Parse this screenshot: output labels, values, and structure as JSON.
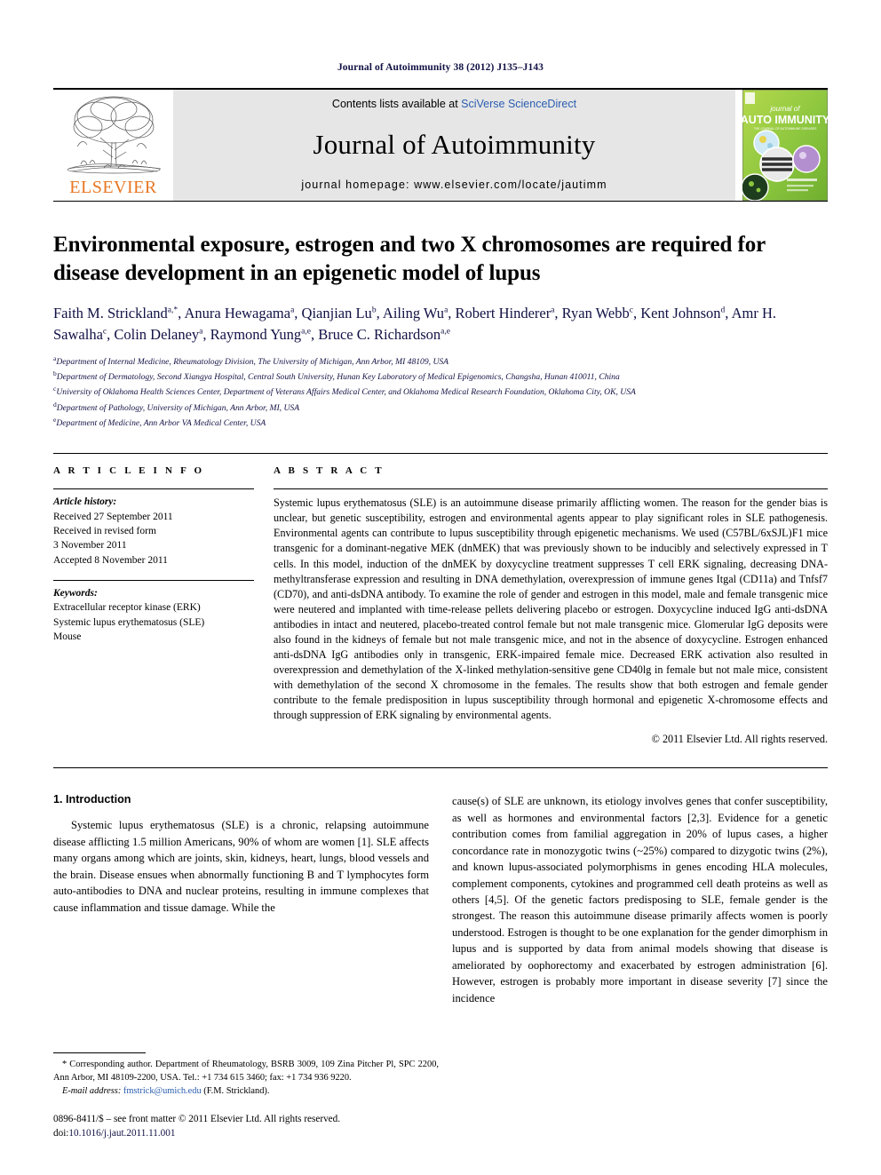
{
  "running_head": "Journal of Autoimmunity 38 (2012) J135–J143",
  "masthead": {
    "publisher_name": "ELSEVIER",
    "contents_prefix": "Contents lists available at ",
    "contents_link": "SciVerse ScienceDirect",
    "journal_name": "Journal of Autoimmunity",
    "homepage_line": "journal homepage: www.elsevier.com/locate/jautimm",
    "cover": {
      "line1": "journal of",
      "line2": "AUTO IMMUNITY",
      "tagline": "THE JOURNAL OF AUTOIMMUNE DISEASES",
      "accent_green": "#8CC63F",
      "accent_dark": "#3F3F3F"
    }
  },
  "article": {
    "title": "Environmental exposure, estrogen and two X chromosomes are required for disease development in an epigenetic model of lupus",
    "authors_html": "Faith M. Strickland<sup>a,*</sup>, Anura Hewagama<sup>a</sup>, Qianjian Lu<sup>b</sup>, Ailing Wu<sup>a</sup>, Robert Hinderer<sup>a</sup>, Ryan Webb<sup>c</sup>, Kent Johnson<sup>d</sup>, Amr H. Sawalha<sup>c</sup>, Colin Delaney<sup>a</sup>, Raymond Yung<sup>a,e</sup>, Bruce C. Richardson<sup>a,e</sup>",
    "affiliations": [
      {
        "mark": "a",
        "text": "Department of Internal Medicine, Rheumatology Division, The University of Michigan, Ann Arbor, MI 48109, USA"
      },
      {
        "mark": "b",
        "text": "Department of Dermatology, Second Xiangya Hospital, Central South University, Hunan Key Laboratory of Medical Epigenomics, Changsha, Hunan 410011, China"
      },
      {
        "mark": "c",
        "text": "University of Oklahoma Health Sciences Center, Department of Veterans Affairs Medical Center, and Oklahoma Medical Research Foundation, Oklahoma City, OK, USA"
      },
      {
        "mark": "d",
        "text": "Department of Pathology, University of Michigan, Ann Arbor, MI, USA"
      },
      {
        "mark": "e",
        "text": "Department of Medicine, Ann Arbor VA Medical Center, USA"
      }
    ]
  },
  "article_info": {
    "heading": "A R T I C L E    I N F O",
    "history_label": "Article history:",
    "history": [
      "Received 27 September 2011",
      "Received in revised form",
      "3 November 2011",
      "Accepted 8 November 2011"
    ],
    "keywords_label": "Keywords:",
    "keywords": [
      "Extracellular receptor kinase (ERK)",
      "Systemic lupus erythematosus (SLE)",
      "Mouse"
    ]
  },
  "abstract": {
    "heading": "A B S T R A C T",
    "text": "Systemic lupus erythematosus (SLE) is an autoimmune disease primarily afflicting women. The reason for the gender bias is unclear, but genetic susceptibility, estrogen and environmental agents appear to play significant roles in SLE pathogenesis. Environmental agents can contribute to lupus susceptibility through epigenetic mechanisms. We used (C57BL/6xSJL)F1 mice transgenic for a dominant-negative MEK (dnMEK) that was previously shown to be inducibly and selectively expressed in T cells. In this model, induction of the dnMEK by doxycycline treatment suppresses T cell ERK signaling, decreasing DNA-methyltransferase expression and resulting in DNA demethylation, overexpression of immune genes Itgal (CD11a) and Tnfsf7 (CD70), and anti-dsDNA antibody. To examine the role of gender and estrogen in this model, male and female transgenic mice were neutered and implanted with time-release pellets delivering placebo or estrogen. Doxycycline induced IgG anti-dsDNA antibodies in intact and neutered, placebo-treated control female but not male transgenic mice. Glomerular IgG deposits were also found in the kidneys of female but not male transgenic mice, and not in the absence of doxycycline. Estrogen enhanced anti-dsDNA IgG antibodies only in transgenic, ERK-impaired female mice. Decreased ERK activation also resulted in overexpression and demethylation of the X-linked methylation-sensitive gene CD40lg in female but not male mice, consistent with demethylation of the second X chromosome in the females. The results show that both estrogen and female gender contribute to the female predisposition in lupus susceptibility through hormonal and epigenetic X-chromosome effects and through suppression of ERK signaling by environmental agents.",
    "copyright": "© 2011 Elsevier Ltd. All rights reserved."
  },
  "introduction": {
    "heading": "1.  Introduction",
    "col_left": "Systemic lupus erythematosus (SLE) is a chronic, relapsing autoimmune disease afflicting 1.5 million Americans, 90% of whom are women [1]. SLE affects many organs among which are joints, skin, kidneys, heart, lungs, blood vessels and the brain. Disease ensues when abnormally functioning B and T lymphocytes form auto-antibodies to DNA and nuclear proteins, resulting in immune complexes that cause inflammation and tissue damage. While the",
    "col_right": "cause(s) of SLE are unknown, its etiology involves genes that confer susceptibility, as well as hormones and environmental factors [2,3]. Evidence for a genetic contribution comes from familial aggregation in 20% of lupus cases, a higher concordance rate in monozygotic twins (~25%) compared to dizygotic twins (2%), and known lupus-associated polymorphisms in genes encoding HLA molecules, complement components, cytokines and programmed cell death proteins as well as others [4,5]. Of the genetic factors predisposing to SLE, female gender is the strongest. The reason this autoimmune disease primarily affects women is poorly understood. Estrogen is thought to be one explanation for the gender dimorphism in lupus and is supported by data from animal models showing that disease is ameliorated by oophorectomy and exacerbated by estrogen administration [6]. However, estrogen is probably more important in disease severity [7] since the incidence"
  },
  "footnotes": {
    "corresponding": "* Corresponding author. Department of Rheumatology, BSRB 3009, 109 Zina Pitcher Pl, SPC 2200, Ann Arbor, MI 48109-2200, USA. Tel.: +1 734 615 3460; fax: +1 734 936 9220.",
    "email_label": "E-mail address:",
    "email": "fmstrick@umich.edu",
    "email_suffix": "(F.M. Strickland).",
    "imprint": "0896-8411/$ – see front matter © 2011 Elsevier Ltd. All rights reserved.",
    "doi_label": "doi:",
    "doi": "10.1016/j.jaut.2011.11.001"
  }
}
